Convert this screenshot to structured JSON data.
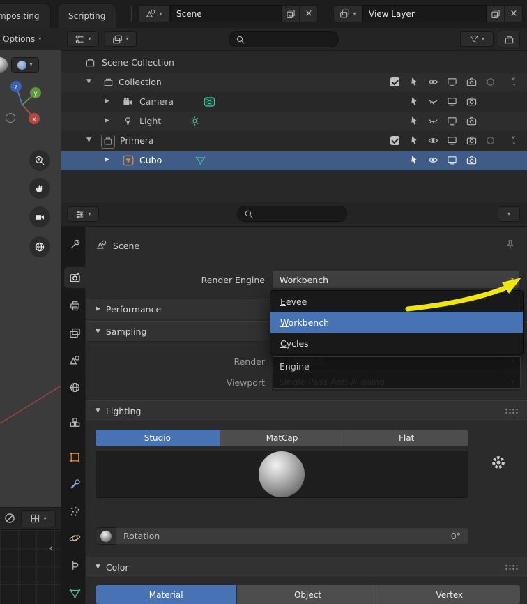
{
  "colors": {
    "accent_blue": "#4772b3",
    "selection_row": "#3e5c85",
    "object_orange": "#e8883a",
    "data_green": "#45c0a2",
    "annotation_yellow": "#f0e60a"
  },
  "topbar": {
    "tabs": [
      {
        "label": "mpositing"
      },
      {
        "label": "Scripting"
      }
    ],
    "scene_selector": {
      "value": "Scene"
    },
    "view_layer_selector": {
      "value": "View Layer"
    }
  },
  "viewport": {
    "options_label": "Options",
    "gizmo": {
      "x": "x",
      "y": "y",
      "z": "z"
    }
  },
  "outliner": {
    "rows": [
      {
        "label": "Scene Collection"
      },
      {
        "label": "Collection"
      },
      {
        "label": "Camera"
      },
      {
        "label": "Light"
      },
      {
        "label": "Primera"
      },
      {
        "label": "Cubo"
      }
    ]
  },
  "properties": {
    "breadcrumb": "Scene",
    "render_engine": {
      "label": "Render Engine",
      "value": "Workbench"
    },
    "engine_menu": {
      "items": [
        {
          "label": "Eevee"
        },
        {
          "label": "Workbench"
        },
        {
          "label": "Cycles"
        }
      ],
      "selected": "Workbench"
    },
    "tooltip_title": "Engine",
    "performance": {
      "label": "Performance"
    },
    "sampling": {
      "label": "Sampling",
      "render_label": "Render",
      "render_value": "8 Samples",
      "viewport_label": "Viewport",
      "viewport_value": "Single Pass Anti-Aliasing"
    },
    "lighting": {
      "label": "Lighting",
      "tabs": [
        {
          "label": "Studio"
        },
        {
          "label": "MatCap"
        },
        {
          "label": "Flat"
        }
      ],
      "rotation_label": "Rotation",
      "rotation_value": "0°"
    },
    "color": {
      "label": "Color",
      "tabs": [
        {
          "label": "Material"
        },
        {
          "label": "Object"
        },
        {
          "label": "Vertex"
        }
      ]
    }
  }
}
